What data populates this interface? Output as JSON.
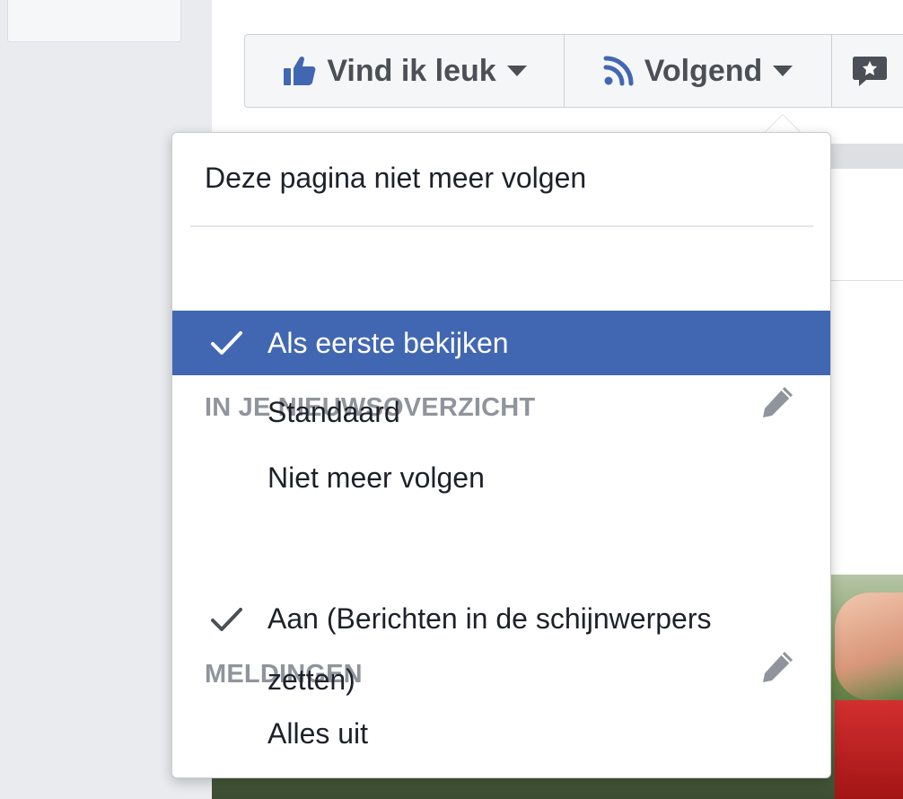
{
  "action_bar": {
    "like_label": "Vind ik leuk",
    "following_label": "Volgend"
  },
  "dropdown": {
    "unfollow_page": "Deze pagina niet meer volgen",
    "newsfeed_header": "IN JE NIEUWSOVERZICHT",
    "newsfeed_options": [
      {
        "label": "Als eerste bekijken",
        "selected": true
      },
      {
        "label": "Standaard",
        "selected": false
      },
      {
        "label": "Niet meer volgen",
        "selected": false
      }
    ],
    "notifications_header": "MELDINGEN",
    "notification_options": [
      {
        "label": "Aan (Berichten in de schijnwerpers zetten)",
        "selected": true
      },
      {
        "label": "Alles uit",
        "selected": false
      }
    ]
  },
  "colors": {
    "selected_bg": "#4267b2",
    "like_icon": "#4267b2",
    "rss_icon": "#4267b2",
    "header_text": "#90949c"
  },
  "icons": [
    "thumbs-up-icon",
    "rss-icon",
    "speech-bubble-icon",
    "pencil-icon",
    "checkmark-icon"
  ]
}
